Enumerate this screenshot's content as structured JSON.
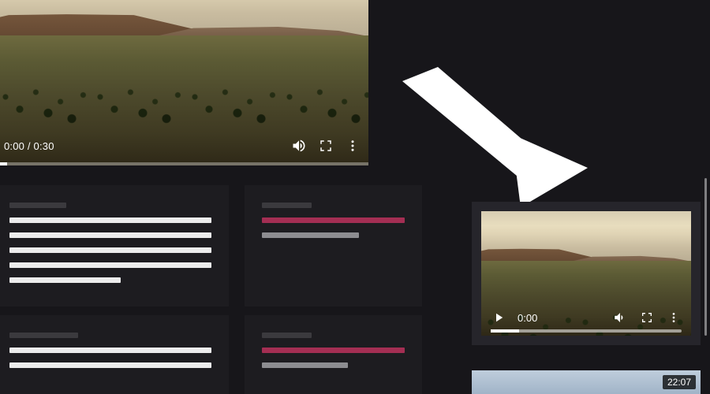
{
  "big_player": {
    "current_time": "0:00",
    "duration": "0:30",
    "time_display": "0:00 / 0:30"
  },
  "mini_player": {
    "current_time": "0:00"
  },
  "next_video": {
    "duration_badge": "22:07"
  },
  "icons": {
    "volume": "volume-icon",
    "fullscreen": "fullscreen-icon",
    "more": "more-vert-icon",
    "play": "play-icon"
  }
}
